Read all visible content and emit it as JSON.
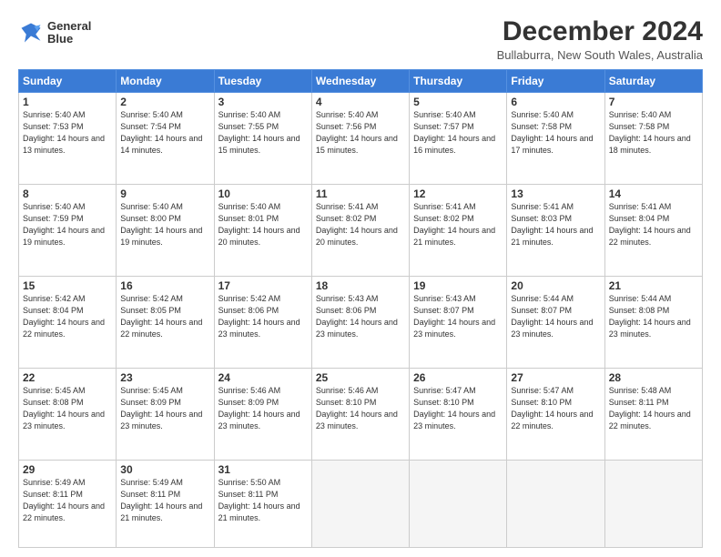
{
  "logo": {
    "text_line1": "General",
    "text_line2": "Blue"
  },
  "header": {
    "title": "December 2024",
    "location": "Bullaburra, New South Wales, Australia"
  },
  "weekdays": [
    "Sunday",
    "Monday",
    "Tuesday",
    "Wednesday",
    "Thursday",
    "Friday",
    "Saturday"
  ],
  "weeks": [
    [
      {
        "day": "1",
        "sunrise": "Sunrise: 5:40 AM",
        "sunset": "Sunset: 7:53 PM",
        "daylight": "Daylight: 14 hours and 13 minutes."
      },
      {
        "day": "2",
        "sunrise": "Sunrise: 5:40 AM",
        "sunset": "Sunset: 7:54 PM",
        "daylight": "Daylight: 14 hours and 14 minutes."
      },
      {
        "day": "3",
        "sunrise": "Sunrise: 5:40 AM",
        "sunset": "Sunset: 7:55 PM",
        "daylight": "Daylight: 14 hours and 15 minutes."
      },
      {
        "day": "4",
        "sunrise": "Sunrise: 5:40 AM",
        "sunset": "Sunset: 7:56 PM",
        "daylight": "Daylight: 14 hours and 15 minutes."
      },
      {
        "day": "5",
        "sunrise": "Sunrise: 5:40 AM",
        "sunset": "Sunset: 7:57 PM",
        "daylight": "Daylight: 14 hours and 16 minutes."
      },
      {
        "day": "6",
        "sunrise": "Sunrise: 5:40 AM",
        "sunset": "Sunset: 7:58 PM",
        "daylight": "Daylight: 14 hours and 17 minutes."
      },
      {
        "day": "7",
        "sunrise": "Sunrise: 5:40 AM",
        "sunset": "Sunset: 7:58 PM",
        "daylight": "Daylight: 14 hours and 18 minutes."
      }
    ],
    [
      {
        "day": "8",
        "sunrise": "Sunrise: 5:40 AM",
        "sunset": "Sunset: 7:59 PM",
        "daylight": "Daylight: 14 hours and 19 minutes."
      },
      {
        "day": "9",
        "sunrise": "Sunrise: 5:40 AM",
        "sunset": "Sunset: 8:00 PM",
        "daylight": "Daylight: 14 hours and 19 minutes."
      },
      {
        "day": "10",
        "sunrise": "Sunrise: 5:40 AM",
        "sunset": "Sunset: 8:01 PM",
        "daylight": "Daylight: 14 hours and 20 minutes."
      },
      {
        "day": "11",
        "sunrise": "Sunrise: 5:41 AM",
        "sunset": "Sunset: 8:02 PM",
        "daylight": "Daylight: 14 hours and 20 minutes."
      },
      {
        "day": "12",
        "sunrise": "Sunrise: 5:41 AM",
        "sunset": "Sunset: 8:02 PM",
        "daylight": "Daylight: 14 hours and 21 minutes."
      },
      {
        "day": "13",
        "sunrise": "Sunrise: 5:41 AM",
        "sunset": "Sunset: 8:03 PM",
        "daylight": "Daylight: 14 hours and 21 minutes."
      },
      {
        "day": "14",
        "sunrise": "Sunrise: 5:41 AM",
        "sunset": "Sunset: 8:04 PM",
        "daylight": "Daylight: 14 hours and 22 minutes."
      }
    ],
    [
      {
        "day": "15",
        "sunrise": "Sunrise: 5:42 AM",
        "sunset": "Sunset: 8:04 PM",
        "daylight": "Daylight: 14 hours and 22 minutes."
      },
      {
        "day": "16",
        "sunrise": "Sunrise: 5:42 AM",
        "sunset": "Sunset: 8:05 PM",
        "daylight": "Daylight: 14 hours and 22 minutes."
      },
      {
        "day": "17",
        "sunrise": "Sunrise: 5:42 AM",
        "sunset": "Sunset: 8:06 PM",
        "daylight": "Daylight: 14 hours and 23 minutes."
      },
      {
        "day": "18",
        "sunrise": "Sunrise: 5:43 AM",
        "sunset": "Sunset: 8:06 PM",
        "daylight": "Daylight: 14 hours and 23 minutes."
      },
      {
        "day": "19",
        "sunrise": "Sunrise: 5:43 AM",
        "sunset": "Sunset: 8:07 PM",
        "daylight": "Daylight: 14 hours and 23 minutes."
      },
      {
        "day": "20",
        "sunrise": "Sunrise: 5:44 AM",
        "sunset": "Sunset: 8:07 PM",
        "daylight": "Daylight: 14 hours and 23 minutes."
      },
      {
        "day": "21",
        "sunrise": "Sunrise: 5:44 AM",
        "sunset": "Sunset: 8:08 PM",
        "daylight": "Daylight: 14 hours and 23 minutes."
      }
    ],
    [
      {
        "day": "22",
        "sunrise": "Sunrise: 5:45 AM",
        "sunset": "Sunset: 8:08 PM",
        "daylight": "Daylight: 14 hours and 23 minutes."
      },
      {
        "day": "23",
        "sunrise": "Sunrise: 5:45 AM",
        "sunset": "Sunset: 8:09 PM",
        "daylight": "Daylight: 14 hours and 23 minutes."
      },
      {
        "day": "24",
        "sunrise": "Sunrise: 5:46 AM",
        "sunset": "Sunset: 8:09 PM",
        "daylight": "Daylight: 14 hours and 23 minutes."
      },
      {
        "day": "25",
        "sunrise": "Sunrise: 5:46 AM",
        "sunset": "Sunset: 8:10 PM",
        "daylight": "Daylight: 14 hours and 23 minutes."
      },
      {
        "day": "26",
        "sunrise": "Sunrise: 5:47 AM",
        "sunset": "Sunset: 8:10 PM",
        "daylight": "Daylight: 14 hours and 23 minutes."
      },
      {
        "day": "27",
        "sunrise": "Sunrise: 5:47 AM",
        "sunset": "Sunset: 8:10 PM",
        "daylight": "Daylight: 14 hours and 22 minutes."
      },
      {
        "day": "28",
        "sunrise": "Sunrise: 5:48 AM",
        "sunset": "Sunset: 8:11 PM",
        "daylight": "Daylight: 14 hours and 22 minutes."
      }
    ],
    [
      {
        "day": "29",
        "sunrise": "Sunrise: 5:49 AM",
        "sunset": "Sunset: 8:11 PM",
        "daylight": "Daylight: 14 hours and 22 minutes."
      },
      {
        "day": "30",
        "sunrise": "Sunrise: 5:49 AM",
        "sunset": "Sunset: 8:11 PM",
        "daylight": "Daylight: 14 hours and 21 minutes."
      },
      {
        "day": "31",
        "sunrise": "Sunrise: 5:50 AM",
        "sunset": "Sunset: 8:11 PM",
        "daylight": "Daylight: 14 hours and 21 minutes."
      },
      null,
      null,
      null,
      null
    ]
  ]
}
